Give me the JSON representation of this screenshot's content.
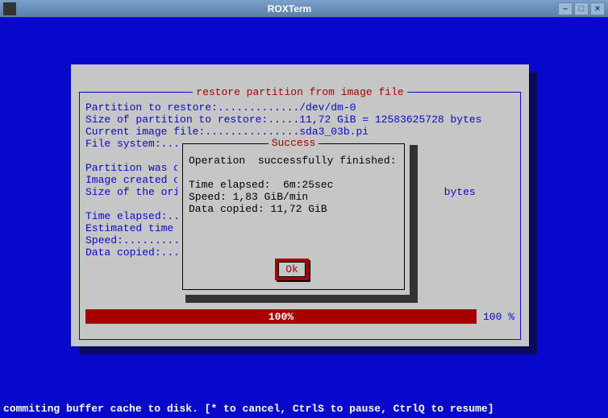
{
  "window": {
    "title": "ROXTerm"
  },
  "winbtns": {
    "minimize": "–",
    "maximize": "□",
    "close": "×"
  },
  "main": {
    "title": "restore partition from image file",
    "lines": "Partition to restore:............./dev/dm-0\nSize of partition to restore:.....11,72 GiB = 12583625728 bytes\nCurrent image file:...............sda3_03b.pi\nFile system:........\n\nPartition was on dev\nImage created on:...\nSize of the original                                     bytes\n\nTime elapsed:.......\nEstimated time remai\nSpeed:..............\nData copied:........"
  },
  "progress": {
    "bar_label": "100%",
    "pct_label": "100 %"
  },
  "modal": {
    "title": "Success",
    "lines": "Operation  successfully finished:\n\nTime elapsed:  6m:25sec\nSpeed: 1,83 GiB/min\nData copied: 11,72 GiB",
    "ok_label": "Ok"
  },
  "status": "commiting buffer cache to disk. [* to cancel, CtrlS to pause, CtrlQ to resume]"
}
